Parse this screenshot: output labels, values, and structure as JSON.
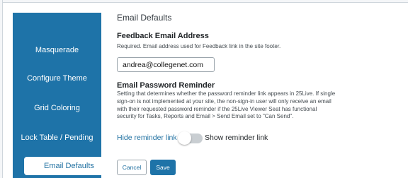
{
  "sidebar": {
    "items": [
      {
        "label": "Masquerade"
      },
      {
        "label": "Configure Theme"
      },
      {
        "label": "Grid Coloring"
      },
      {
        "label": "Lock Table / Pending"
      },
      {
        "label": "Email Defaults",
        "active": true
      }
    ]
  },
  "main": {
    "section_title": "Email Defaults",
    "feedback": {
      "label": "Feedback Email Address",
      "help": "Required. Email address used for Feedback link in the site footer.",
      "value": "andrea@collegenet.com"
    },
    "reminder": {
      "label": "Email Password Reminder",
      "help_lines": [
        "Setting that determines whether the password reminder link appears in 25Live. If single",
        "sign-on is not implemented at your site, the non-sign-in user will only receive an email",
        "with their requested password reminder if the 25Live Viewer Seat has functional",
        "security for Tasks, Reports and Email > Send Email set to \"Can Send\"."
      ],
      "toggle_left_label": "Hide reminder link",
      "toggle_right_label": "Show reminder link",
      "toggle_state": "hide"
    },
    "buttons": {
      "cancel": "Cancel",
      "save": "Save"
    }
  },
  "colors": {
    "sidebar_bg": "#1e73a8",
    "link": "#1e6fa0",
    "toggle_track": "#c9ced2"
  }
}
